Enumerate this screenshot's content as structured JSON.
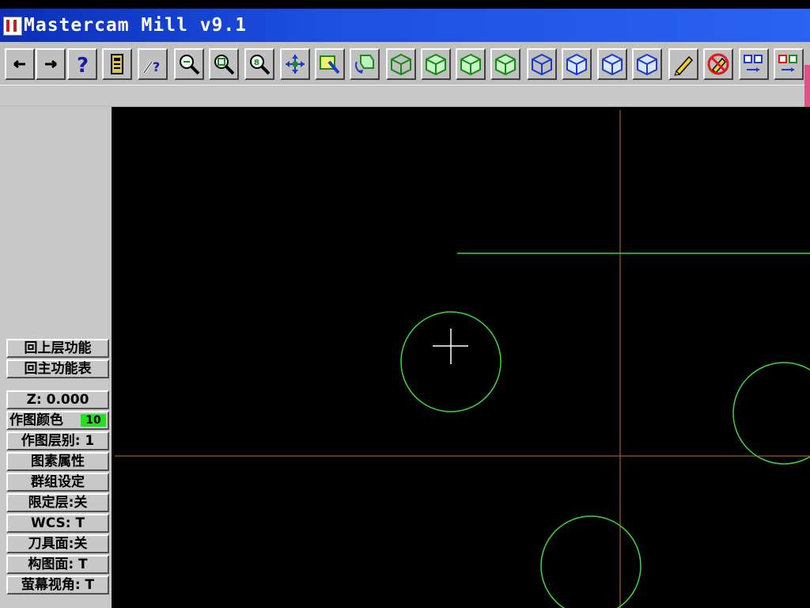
{
  "window": {
    "title": "Mastercam Mill v9.1"
  },
  "toolbar": {
    "buttons": [
      {
        "name": "back-arrow-icon",
        "glyph": "←"
      },
      {
        "name": "forward-arrow-icon",
        "glyph": "→"
      },
      {
        "name": "help-icon",
        "glyph": "?"
      },
      {
        "name": "calculator-icon",
        "glyph": ""
      },
      {
        "name": "analyze-icon",
        "glyph": ""
      },
      {
        "name": "zoom-window-icon",
        "glyph": ""
      },
      {
        "name": "zoom-fit-icon",
        "glyph": ""
      },
      {
        "name": "zoom-out-icon",
        "glyph": ""
      },
      {
        "name": "pan-icon",
        "glyph": ""
      },
      {
        "name": "select-icon",
        "glyph": ""
      },
      {
        "name": "rotate-icon",
        "glyph": ""
      },
      {
        "name": "view-top-green-icon",
        "glyph": ""
      },
      {
        "name": "view-front-green-icon",
        "glyph": ""
      },
      {
        "name": "view-side-green-icon",
        "glyph": ""
      },
      {
        "name": "view-iso-green-icon",
        "glyph": ""
      },
      {
        "name": "cplane-top-blue-icon",
        "glyph": ""
      },
      {
        "name": "cplane-front-blue-icon",
        "glyph": ""
      },
      {
        "name": "cplane-side-blue-icon",
        "glyph": ""
      },
      {
        "name": "cplane-iso-blue-icon",
        "glyph": ""
      },
      {
        "name": "pencil-icon",
        "glyph": ""
      },
      {
        "name": "no-pencil-icon",
        "glyph": ""
      },
      {
        "name": "copy-blue-icon",
        "glyph": ""
      },
      {
        "name": "copy-color-icon",
        "glyph": ""
      }
    ]
  },
  "menu": {
    "items": [
      {
        "name": "menu-back-level",
        "label": "回上层功能"
      },
      {
        "name": "menu-main-menu",
        "label": "回主功能表"
      }
    ]
  },
  "status": {
    "items": [
      {
        "name": "status-z-depth",
        "label": "Z:  0.000"
      },
      {
        "name": "status-draw-color",
        "label": "作图颜色",
        "value": "10",
        "swatch": "#22e022"
      },
      {
        "name": "status-draw-level",
        "label": "作图层别: 1"
      },
      {
        "name": "status-entity-attrib",
        "label": "图素属性"
      },
      {
        "name": "status-group",
        "label": "群组设定"
      },
      {
        "name": "status-level-mask",
        "label": "限定层:关"
      },
      {
        "name": "status-wcs",
        "label": "WCS:  T"
      },
      {
        "name": "status-tool-plane",
        "label": "刀具面:关"
      },
      {
        "name": "status-const-plane",
        "label": "构图面: T"
      },
      {
        "name": "status-screen-view",
        "label": "萤幕视角: T"
      }
    ]
  },
  "colors": {
    "axis": "#8a4a14",
    "geometry": "#38d838",
    "cursor": "#ffffff",
    "swatch_green": "#22e022"
  }
}
